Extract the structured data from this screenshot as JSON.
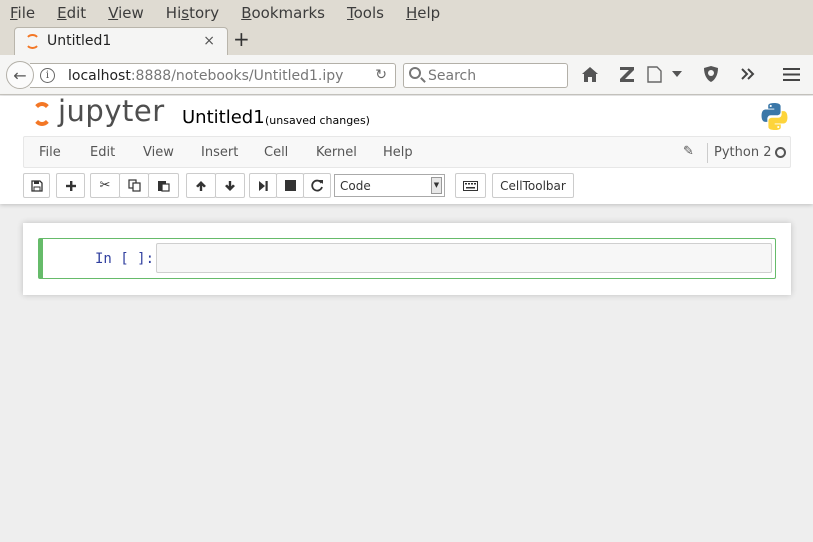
{
  "browser": {
    "menu": [
      {
        "first": "F",
        "rest": "ile"
      },
      {
        "first": "E",
        "rest": "dit"
      },
      {
        "first": "V",
        "rest": "iew"
      },
      {
        "first": "",
        "pre": "Hi",
        "u": "s",
        "post": "tory"
      },
      {
        "first": "B",
        "rest": "ookmarks"
      },
      {
        "first": "T",
        "rest": "ools"
      },
      {
        "first": "H",
        "rest": "elp"
      }
    ],
    "menu_labels": [
      "File",
      "Edit",
      "View",
      "History",
      "Bookmarks",
      "Tools",
      "Help"
    ],
    "tab_title": "Untitled1",
    "tab_close": "×",
    "new_tab": "+",
    "url_host": "localhost",
    "url_rest": ":8888/notebooks/Untitled1.ipy",
    "search_placeholder": "Search",
    "back_glyph": "←",
    "info_glyph": "i",
    "reload_glyph": "↻"
  },
  "jupyter": {
    "brand": "jupyter",
    "notebook_name": "Untitled1",
    "save_status": "(unsaved changes)",
    "menu": [
      "File",
      "Edit",
      "View",
      "Insert",
      "Cell",
      "Kernel",
      "Help"
    ],
    "kernel_name": "Python 2",
    "cell_type": "Code",
    "celltoolbar_label": "CellToolbar",
    "prompt": "In [ ]:"
  },
  "colors": {
    "jupyter_orange": "#f37726",
    "cell_selected_border": "#66bb6a",
    "prompt_blue": "#303f9f"
  }
}
